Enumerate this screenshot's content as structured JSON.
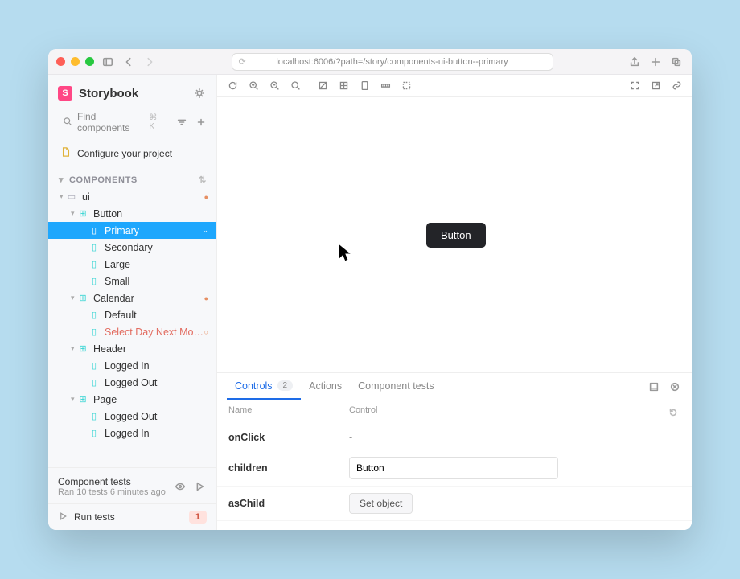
{
  "window": {
    "url": "localhost:6006/?path=/story/components-ui-button--primary"
  },
  "brand": {
    "name": "Storybook",
    "logo_letter": "S"
  },
  "search": {
    "placeholder": "Find components",
    "shortcut": "⌘ K"
  },
  "configure_label": "Configure your project",
  "section": {
    "title": "COMPONENTS"
  },
  "tree": {
    "ui": "ui",
    "button": "Button",
    "button_primary": "Primary",
    "button_secondary": "Secondary",
    "button_large": "Large",
    "button_small": "Small",
    "calendar": "Calendar",
    "calendar_default": "Default",
    "calendar_select_day": "Select Day Next Month",
    "header": "Header",
    "header_logged_in": "Logged In",
    "header_logged_out": "Logged Out",
    "page": "Page",
    "page_logged_out": "Logged Out",
    "page_logged_in": "Logged In"
  },
  "component_tests": {
    "title": "Component tests",
    "meta": "Ran 10 tests 6 minutes ago"
  },
  "run_tests": {
    "label": "Run tests",
    "count": "1"
  },
  "preview": {
    "button_text": "Button"
  },
  "panel": {
    "tabs": {
      "controls": "Controls",
      "controls_count": "2",
      "actions": "Actions",
      "component_tests": "Component tests"
    },
    "headers": {
      "name": "Name",
      "control": "Control"
    },
    "rows": {
      "onclick": {
        "name": "onClick",
        "value": "-"
      },
      "children": {
        "name": "children",
        "value": "Button"
      },
      "aschild": {
        "name": "asChild",
        "btn": "Set object"
      }
    }
  }
}
